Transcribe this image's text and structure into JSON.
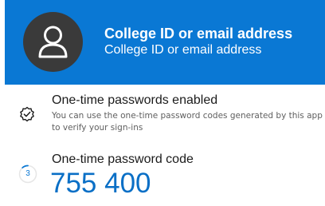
{
  "account": {
    "name": "College ID or email address",
    "email": "College ID or email address",
    "avatar_icon": "person-icon",
    "header_color": "#0a78d4"
  },
  "otp_status": {
    "icon": "badge-check-icon",
    "title": "One-time passwords enabled",
    "description": "You can use the one-time password codes generated by this app to verify your sign-ins"
  },
  "otp_code": {
    "label": "One-time password code",
    "code": "755 400",
    "seconds_remaining": "3",
    "accent_color": "#0a78d4"
  }
}
